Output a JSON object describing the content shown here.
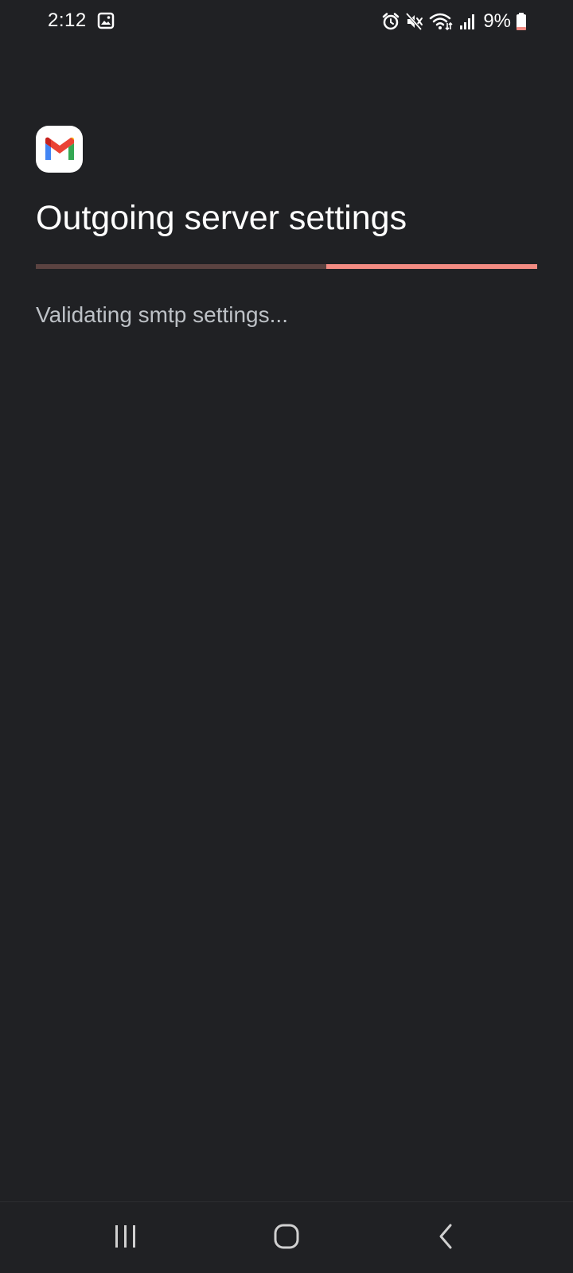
{
  "status_bar": {
    "time": "2:12",
    "battery_percent": "9%",
    "battery_level": 0.09,
    "left_icons": [
      "image-notification-icon"
    ],
    "right_icons": [
      "alarm-icon",
      "mute-icon",
      "wifi-icon",
      "signal-icon",
      "battery-icon"
    ]
  },
  "app": {
    "logo_icon": "gmail-logo-icon"
  },
  "page": {
    "title": "Outgoing server settings",
    "status_message": "Validating smtp settings...",
    "progress": {
      "mode": "indeterminate",
      "indicator_start": 0.58,
      "indicator_end": 1.0
    }
  },
  "colors": {
    "background": "#202124",
    "progress_track": "#5b4341",
    "progress_indicator": "#f28b82",
    "battery_low": "#f28b82"
  },
  "nav_bar": {
    "buttons": [
      "recents-icon",
      "home-icon",
      "back-icon"
    ]
  }
}
